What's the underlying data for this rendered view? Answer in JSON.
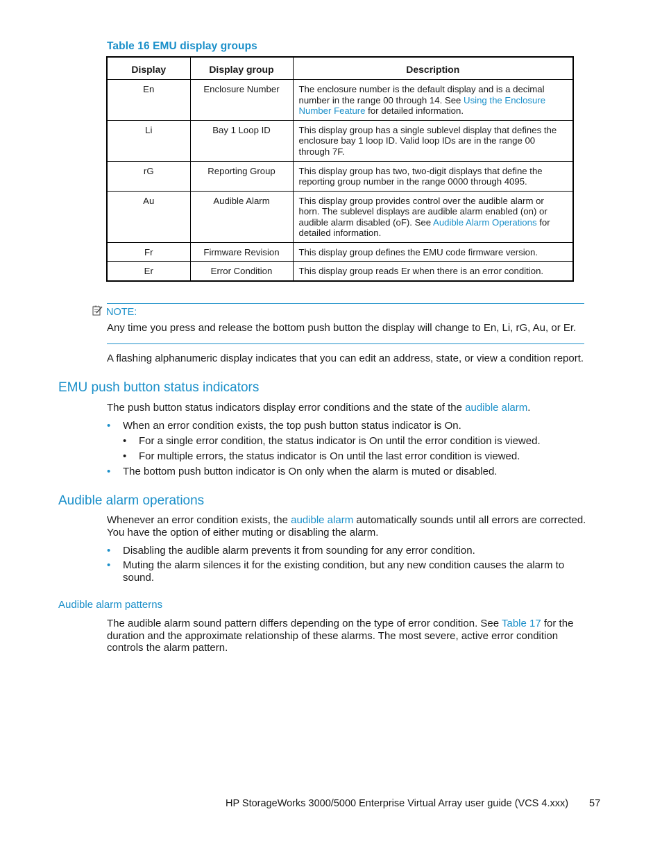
{
  "table": {
    "title": "Table 16 EMU display groups",
    "headers": [
      "Display",
      "Display group",
      "Description"
    ],
    "rows": [
      {
        "display": "En",
        "group": "Enclosure Number",
        "desc_before": "The enclosure number is the default display and is a decimal number in the range 00 through 14.  See ",
        "desc_link": "Using the Enclosure Number Feature",
        "desc_after": " for detailed information."
      },
      {
        "display": "Li",
        "group": "Bay 1 Loop ID",
        "desc_before": "This display group has a single sublevel display that defines the enclosure bay 1 loop ID. Valid loop IDs are in the range 00 through 7F.",
        "desc_link": "",
        "desc_after": ""
      },
      {
        "display": "rG",
        "group": "Reporting Group",
        "desc_before": "This display group has two, two-digit displays that define the reporting group number in the range 0000 through 4095.",
        "desc_link": "",
        "desc_after": ""
      },
      {
        "display": "Au",
        "group": "Audible Alarm",
        "desc_before": "This display group provides control over the audible alarm or horn.  The sublevel displays are audible alarm enabled (on) or audible alarm disabled (oF). See ",
        "desc_link": "Audible Alarm Operations",
        "desc_after": " for detailed information."
      },
      {
        "display": "Fr",
        "group": "Firmware Revision",
        "desc_before": "This display group defines the EMU code firmware version.",
        "desc_link": "",
        "desc_after": ""
      },
      {
        "display": "Er",
        "group": "Error Condition",
        "desc_before": "This display group reads Er when there is an error condition.",
        "desc_link": "",
        "desc_after": ""
      }
    ]
  },
  "note": {
    "icon": "note-pencil-icon",
    "label": "NOTE:",
    "text": "Any time you press and release the bottom push button the display will change to En, Li, rG, Au, or Er."
  },
  "flashing_paragraph": "A flashing alphanumeric display indicates that you can edit an address, state, or view a condition report.",
  "section_push": {
    "heading": "EMU push button status indicators",
    "intro_before": "The push button status indicators display error conditions and the state of the ",
    "intro_link": "audible alarm",
    "intro_after": ".",
    "bullet1": "When an error condition exists, the top push button status indicator is On.",
    "sub1": "For a single error condition, the status indicator is On until the error condition is viewed.",
    "sub2": "For multiple errors, the status indicator is On until the last error condition is viewed.",
    "bullet2": "The bottom push button indicator is On only when the alarm is muted or disabled."
  },
  "section_alarm": {
    "heading": "Audible alarm operations",
    "intro_before": "Whenever an error condition exists, the ",
    "intro_link": "audible alarm",
    "intro_after": " automatically sounds until all errors are corrected. You have the option of either muting or disabling the alarm.",
    "bullet1": "Disabling the audible alarm prevents it from sounding for any error condition.",
    "bullet2": "Muting the alarm silences it for the existing condition, but any new condition causes the alarm to sound."
  },
  "section_patterns": {
    "heading": "Audible alarm patterns",
    "text_before": "The audible alarm sound pattern differs depending on the type of error condition.  See ",
    "text_link": "Table 17",
    "text_after": " for the duration and the approximate relationship of these alarms.  The most severe, active error condition controls the alarm pattern."
  },
  "footer": {
    "title": "HP StorageWorks 3000/5000 Enterprise Virtual Array user guide (VCS 4.xxx)",
    "page_number": "57"
  }
}
